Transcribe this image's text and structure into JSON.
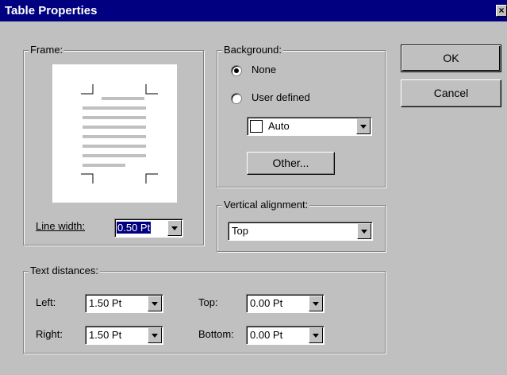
{
  "dialog": {
    "title": "Table Properties",
    "close_label": "×"
  },
  "frame": {
    "legend": "Frame:",
    "line_width_label": "Line width:",
    "line_width_value": "0.50 Pt"
  },
  "background": {
    "legend": "Background:",
    "none_label": "None",
    "user_defined_label": "User defined",
    "color_value": "Auto",
    "other_button": "Other...",
    "selected": "None"
  },
  "vertical_alignment": {
    "legend": "Vertical alignment:",
    "value": "Top"
  },
  "text_distances": {
    "legend": "Text distances:",
    "left_label": "Left:",
    "left_value": "1.50 Pt",
    "right_label": "Right:",
    "right_value": "1.50 Pt",
    "top_label": "Top:",
    "top_value": "0.00 Pt",
    "bottom_label": "Bottom:",
    "bottom_value": "0.00 Pt"
  },
  "buttons": {
    "ok": "OK",
    "cancel": "Cancel"
  },
  "colors": {
    "titlebar": "#000080",
    "face": "#c0c0c0",
    "selection": "#000080"
  }
}
